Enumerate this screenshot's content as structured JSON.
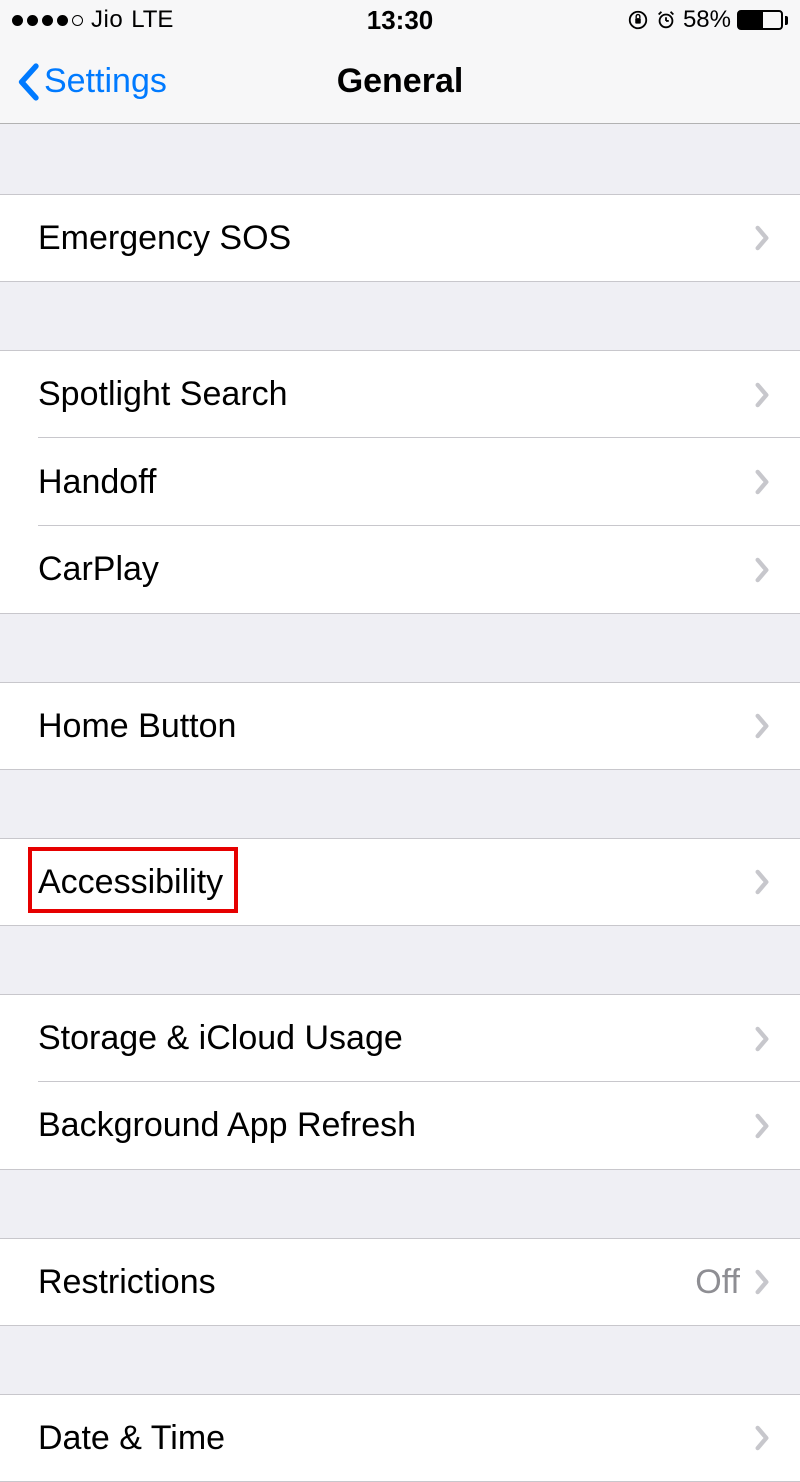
{
  "status": {
    "carrier": "Jio",
    "network": "LTE",
    "time": "13:30",
    "battery_percent": "58%"
  },
  "nav": {
    "back_label": "Settings",
    "title": "General"
  },
  "groups": [
    {
      "items": [
        {
          "key": "emergency-sos",
          "label": "Emergency SOS"
        }
      ]
    },
    {
      "items": [
        {
          "key": "spotlight-search",
          "label": "Spotlight Search"
        },
        {
          "key": "handoff",
          "label": "Handoff"
        },
        {
          "key": "carplay",
          "label": "CarPlay"
        }
      ]
    },
    {
      "items": [
        {
          "key": "home-button",
          "label": "Home Button"
        }
      ]
    },
    {
      "items": [
        {
          "key": "accessibility",
          "label": "Accessibility",
          "highlighted": true
        }
      ]
    },
    {
      "items": [
        {
          "key": "storage-icloud-usage",
          "label": "Storage & iCloud Usage"
        },
        {
          "key": "background-app-refresh",
          "label": "Background App Refresh"
        }
      ]
    },
    {
      "items": [
        {
          "key": "restrictions",
          "label": "Restrictions",
          "value": "Off"
        }
      ]
    },
    {
      "items": [
        {
          "key": "date-time",
          "label": "Date & Time"
        }
      ]
    }
  ]
}
